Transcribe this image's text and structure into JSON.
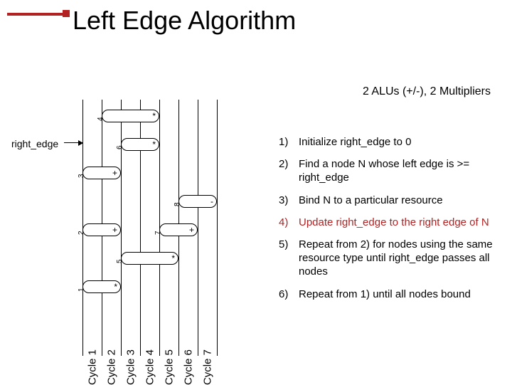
{
  "title": "Left Edge Algorithm",
  "subtitle": "2 ALUs (+/-), 2 Multipliers",
  "right_edge_label": "right_edge",
  "steps": [
    {
      "num": "1)",
      "text": "Initialize right_edge to 0",
      "highlight": false
    },
    {
      "num": "2)",
      "text": "Find a node N whose left edge is >= right_edge",
      "highlight": false
    },
    {
      "num": "3)",
      "text": "Bind N to a particular resource",
      "highlight": false
    },
    {
      "num": "4)",
      "text": "Update right_edge to the right edge of N",
      "highlight": true
    },
    {
      "num": "5)",
      "text": "Repeat from 2) for nodes using the same resource type until right_edge passes all nodes",
      "highlight": false
    },
    {
      "num": "6)",
      "text": "Repeat from 1) until all nodes bound",
      "highlight": false
    }
  ],
  "cycles": [
    "Cycle 1",
    "Cycle 2",
    "Cycle 3",
    "Cycle 4",
    "Cycle 5",
    "Cycle 6",
    "Cycle 7"
  ],
  "chart_data": {
    "type": "table",
    "description": "Operation intervals on a 7-cycle timeline",
    "cycle_count": 7,
    "right_edge_initial": 0,
    "resources": {
      "alu": 2,
      "multiplier": 2
    },
    "nodes": [
      {
        "id": 1,
        "op": "*",
        "start": 1,
        "end": 2,
        "row": 6
      },
      {
        "id": 2,
        "op": "+",
        "start": 1,
        "end": 2,
        "row": 4
      },
      {
        "id": 3,
        "op": "+",
        "start": 1,
        "end": 2,
        "row": 2
      },
      {
        "id": 4,
        "op": "*",
        "start": 2,
        "end": 4,
        "row": 0
      },
      {
        "id": 5,
        "op": "*",
        "start": 3,
        "end": 5,
        "row": 5
      },
      {
        "id": 6,
        "op": "*",
        "start": 3,
        "end": 4,
        "row": 1
      },
      {
        "id": 7,
        "op": "+",
        "start": 5,
        "end": 6,
        "row": 4
      },
      {
        "id": 8,
        "op": "-",
        "start": 6,
        "end": 7,
        "row": 3
      }
    ]
  }
}
